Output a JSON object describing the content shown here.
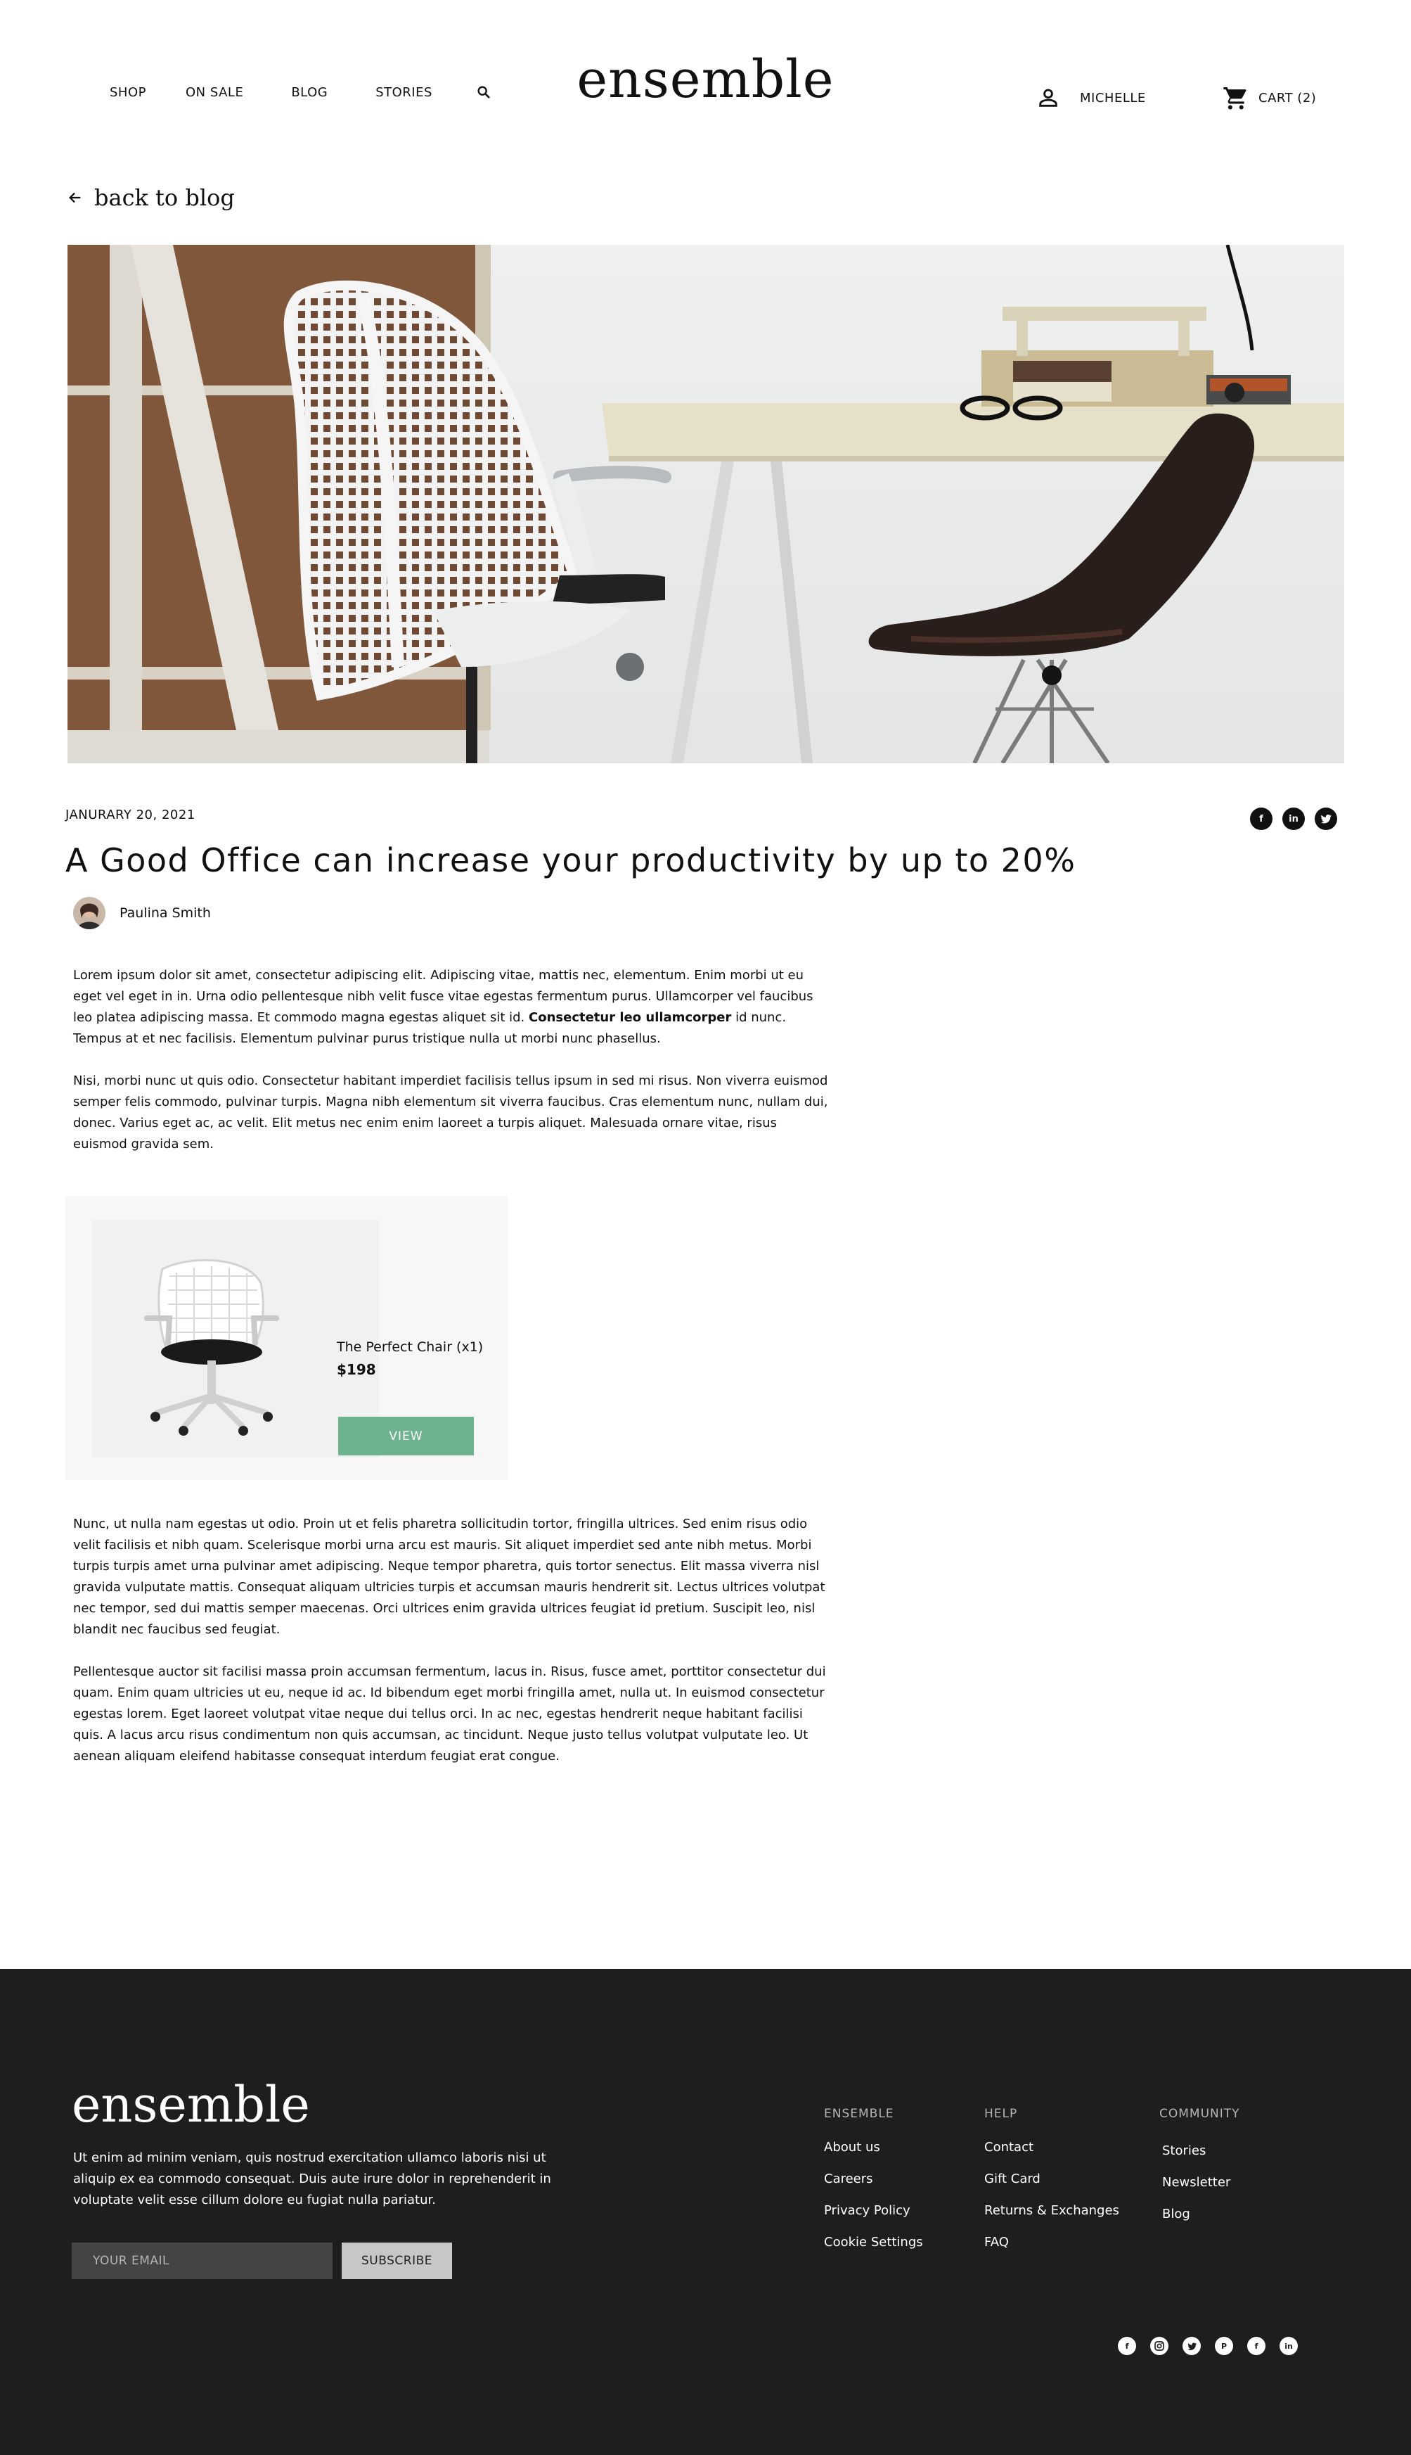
{
  "header": {
    "nav": [
      "SHOP",
      "ON SALE",
      "BLOG",
      "STORIES"
    ],
    "logo": "ensemble",
    "user_label": "MICHELLE",
    "cart_label": "CART (2)"
  },
  "back_link": "back to blog",
  "article": {
    "date": "JANURARY 20, 2021",
    "title": "A Good Office can increase your productivity by up to 20%",
    "author": "Paulina Smith",
    "p1_start": "Lorem ipsum dolor sit amet, consectetur adipiscing elit. Adipiscing vitae, mattis nec, elementum. Enim morbi ut eu eget vel eget in in. Urna odio pellentesque nibh velit fusce vitae egestas fermentum purus. Ullamcorper vel faucibus leo platea adipiscing massa. Et commodo magna egestas aliquet sit id.",
    "p1_bold": "Consectetur leo ullamcorper",
    "p1_end": "id nunc. Tempus at et nec facilisis. Elementum pulvinar purus tristique nulla ut morbi nunc phasellus.",
    "p2": "Nisi, morbi nunc ut quis odio. Consectetur habitant imperdiet facilisis tellus ipsum in sed mi risus. Non viverra euismod semper felis commodo, pulvinar turpis. Magna nibh elementum sit viverra faucibus. Cras elementum nunc, nullam dui, donec. Varius eget ac, ac velit. Elit metus nec enim enim laoreet a turpis aliquet. Malesuada ornare vitae, risus euismod gravida sem.",
    "p3": "Nunc, ut nulla nam egestas ut odio. Proin ut et felis pharetra sollicitudin tortor, fringilla ultrices. Sed enim risus odio velit facilisis et nibh quam. Scelerisque morbi urna arcu est mauris. Sit aliquet imperdiet sed ante nibh metus. Morbi turpis turpis amet urna pulvinar amet adipiscing. Neque tempor pharetra, quis tortor senectus. Elit massa viverra nisl gravida vulputate mattis. Consequat aliquam ultricies turpis et accumsan mauris hendrerit sit. Lectus ultrices volutpat nec tempor, sed dui mattis semper maecenas. Orci ultrices enim gravida ultrices feugiat id pretium. Suscipit leo, nisl blandit nec faucibus sed feugiat.",
    "p4": "Pellentesque auctor sit facilisi massa proin accumsan fermentum, lacus in. Risus, fusce amet, porttitor consectetur dui quam. Enim quam ultricies ut eu, neque id ac. Id bibendum eget morbi fringilla amet, nulla ut. In euismod consectetur egestas lorem. Eget laoreet volutpat vitae neque dui tellus orci. In ac nec, egestas hendrerit neque habitant facilisi quis. A lacus arcu risus condimentum non quis accumsan, ac tincidunt. Neque justo tellus volutpat vulputate leo. Ut aenean aliquam eleifend habitasse consequat interdum feugiat erat congue."
  },
  "product": {
    "name": "The Perfect Chair (x1)",
    "price": "$198",
    "button": "VIEW"
  },
  "footer": {
    "logo": "ensemble",
    "description": "Ut enim ad minim veniam, quis nostrud exercitation ullamco laboris nisi ut aliquip ex ea commodo consequat. Duis aute irure dolor in reprehenderit in voluptate velit esse cillum dolore eu fugiat nulla pariatur.",
    "email_placeholder": "YOUR EMAIL",
    "subscribe": "SUBSCRIBE",
    "columns": [
      {
        "title": "ENSEMBLE",
        "links": [
          "About us",
          "Careers",
          "Privacy Policy",
          "Cookie Settings"
        ]
      },
      {
        "title": "HELP",
        "links": [
          "Contact",
          "Gift Card",
          "Returns & Exchanges",
          "FAQ"
        ]
      },
      {
        "title": "COMMUNITY",
        "links": [
          "Stories",
          "Newsletter",
          "Blog"
        ]
      }
    ]
  },
  "icons": {
    "share": [
      "facebook-icon",
      "linkedin-icon",
      "twitter-icon"
    ],
    "footer_social": [
      "facebook-icon",
      "instagram-icon",
      "twitter-icon",
      "pinterest-icon",
      "facebook-icon",
      "linkedin-icon"
    ]
  },
  "colors": {
    "accent_green": "#6db38e",
    "footer_bg": "#1e1e1e"
  }
}
